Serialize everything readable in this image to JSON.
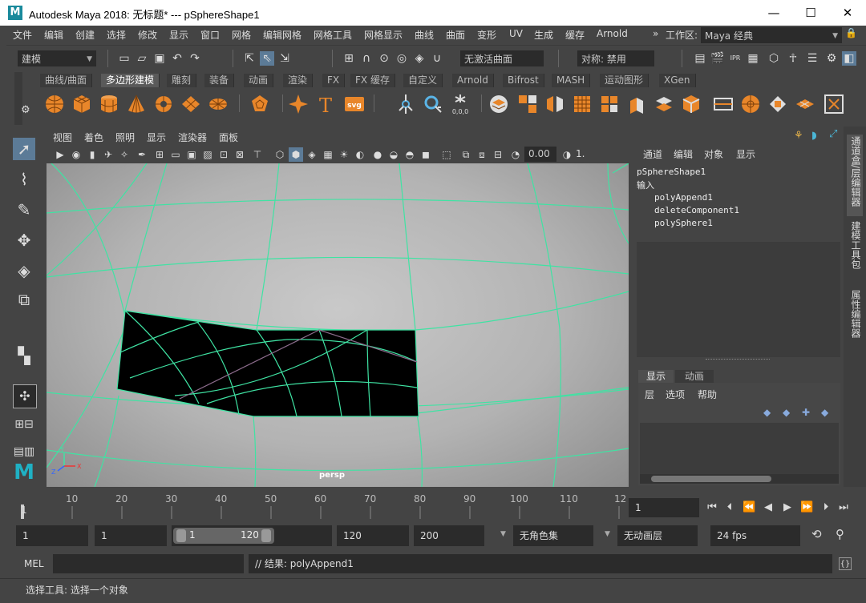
{
  "window": {
    "title": "Autodesk Maya 2018: 无标题*   ---   pSphereShape1",
    "logo": "M",
    "minimize": "—",
    "maximize": "☐",
    "close": "✕"
  },
  "menubar": [
    "文件",
    "编辑",
    "创建",
    "选择",
    "修改",
    "显示",
    "窗口",
    "网格",
    "编辑网格",
    "网格工具",
    "网格显示",
    "曲线",
    "曲面",
    "变形",
    "UV",
    "生成",
    "缓存",
    "Arnold"
  ],
  "workspace": {
    "label": "工作区:",
    "value": "Maya 经典"
  },
  "statusline": {
    "mode": "建模",
    "live_surface": "无激活曲面",
    "symmetry": "对称: 禁用"
  },
  "shelf_tabs": [
    "曲线/曲面",
    "多边形建模",
    "雕刻",
    "装备",
    "动画",
    "渲染",
    "FX",
    "FX 缓存",
    "自定义",
    "Arnold",
    "Bifrost",
    "MASH",
    "运动图形",
    "XGen"
  ],
  "shelf_active": "多边形建模",
  "viewport_menu": [
    "视图",
    "着色",
    "照明",
    "显示",
    "渲染器",
    "面板"
  ],
  "viewport": {
    "exposure": "0.00",
    "gamma": "1.",
    "camera": "persp"
  },
  "channel_box": {
    "menu": [
      "通道",
      "编辑",
      "对象",
      "显示"
    ],
    "node": "pSphereShape1",
    "inputs_label": "输入",
    "inputs": [
      "polyAppend1",
      "deleteComponent1",
      "polySphere1"
    ]
  },
  "layer_editor": {
    "tabs": [
      "显示",
      "动画"
    ],
    "menu": [
      "层",
      "选项",
      "帮助"
    ]
  },
  "side_tabs": [
    "通道盒/层编辑器",
    "建模工具包",
    "属性编辑器"
  ],
  "timeline": {
    "ticks": [
      "1",
      "10",
      "20",
      "30",
      "40",
      "50",
      "60",
      "70",
      "80",
      "90",
      "100",
      "110",
      "12"
    ],
    "current_frame": "1"
  },
  "range": {
    "start": "1",
    "playback_start": "1",
    "slider_start": "1",
    "slider_end": "120",
    "playback_end": "120",
    "end": "200",
    "char_set": "无角色集",
    "anim_layer": "无动画层",
    "fps": "24 fps"
  },
  "cmdline": {
    "lang": "MEL",
    "result": "// 结果: polyAppend1"
  },
  "helpline": {
    "text": "选择工具: 选择一个对象"
  },
  "colors": {
    "wire": "#3fe3a3",
    "viewport_bg": "#b8b8b8",
    "ui_bg": "#444444"
  }
}
